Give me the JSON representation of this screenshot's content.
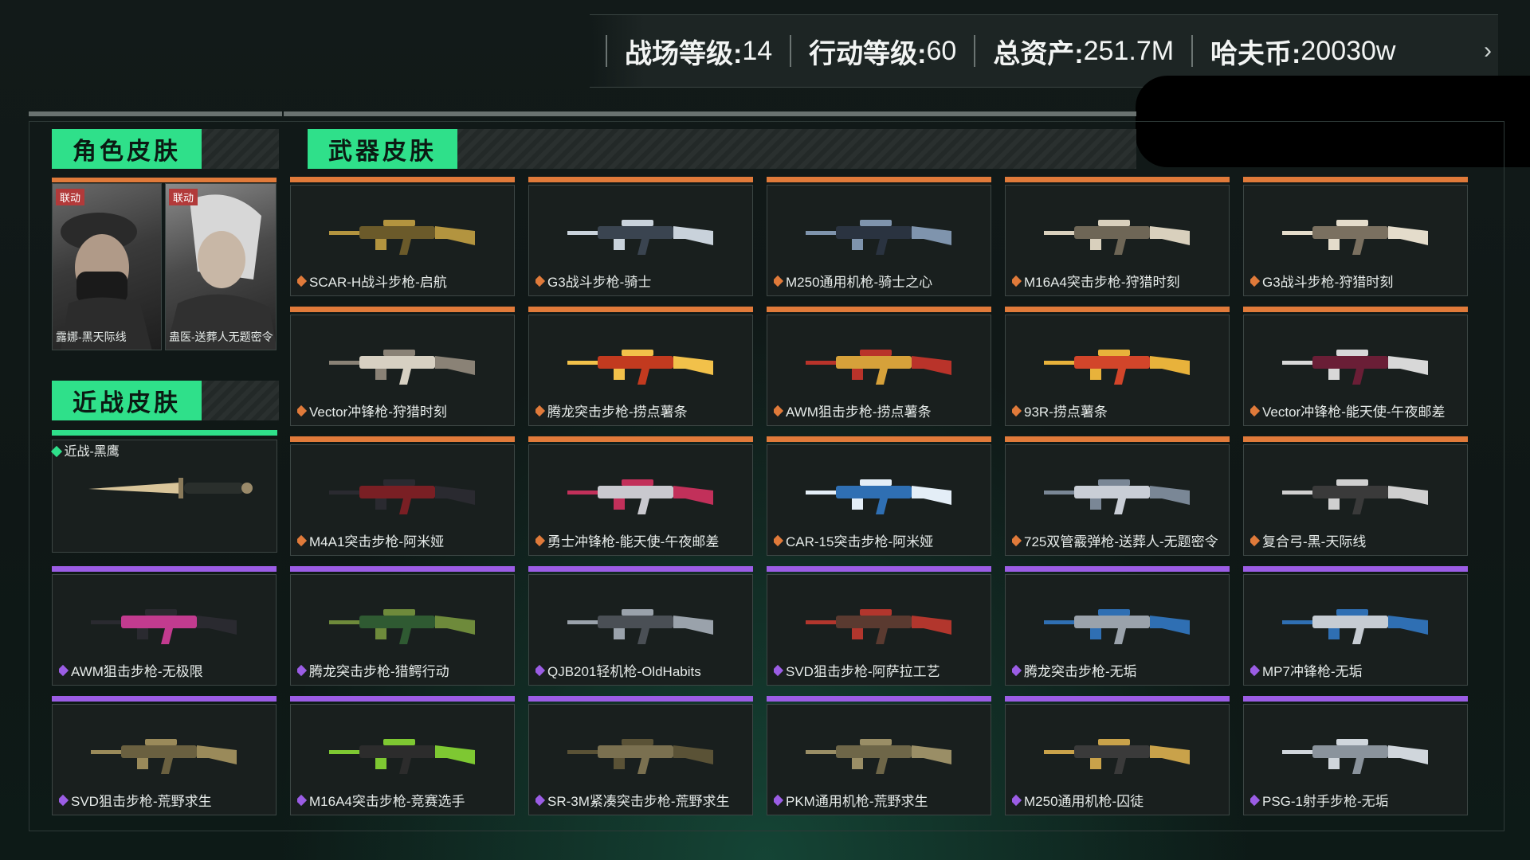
{
  "stats": [
    {
      "label": "战场等级:",
      "value": "14"
    },
    {
      "label": "行动等级:",
      "value": "60"
    },
    {
      "label": "总资产:",
      "value": "251.7M"
    },
    {
      "label": "哈夫币:",
      "value": "20030w"
    }
  ],
  "sections": {
    "character": "角色皮肤",
    "weapon": "武器皮肤",
    "melee": "近战皮肤"
  },
  "characters": [
    {
      "tag": "联动",
      "name": "露娜-黑天际线"
    },
    {
      "tag": "联动",
      "name": "蛊医-送葬人无题密令"
    }
  ],
  "melee_item": {
    "name": "近战-黑鹰"
  },
  "colors": {
    "accent": "#2fe08a",
    "orange": "#e07a3a",
    "purple": "#9b5de5"
  },
  "weapons": [
    {
      "name": "SCAR-H战斗步枪-启航",
      "tier": "orange"
    },
    {
      "name": "G3战斗步枪-骑士",
      "tier": "orange"
    },
    {
      "name": "M250通用机枪-骑士之心",
      "tier": "orange"
    },
    {
      "name": "M16A4突击步枪-狩猎时刻",
      "tier": "orange"
    },
    {
      "name": "G3战斗步枪-狩猎时刻",
      "tier": "orange"
    },
    {
      "name": "Vector冲锋枪-狩猎时刻",
      "tier": "orange"
    },
    {
      "name": "腾龙突击步枪-捞点薯条",
      "tier": "orange"
    },
    {
      "name": "AWM狙击步枪-捞点薯条",
      "tier": "orange"
    },
    {
      "name": "93R-捞点薯条",
      "tier": "orange"
    },
    {
      "name": "Vector冲锋枪-能天使-午夜邮差",
      "tier": "orange"
    },
    {
      "name": "M4A1突击步枪-阿米娅",
      "tier": "orange"
    },
    {
      "name": "勇士冲锋枪-能天使-午夜邮差",
      "tier": "orange"
    },
    {
      "name": "CAR-15突击步枪-阿米娅",
      "tier": "orange"
    },
    {
      "name": "725双管霰弹枪-送葬人-无题密令",
      "tier": "orange"
    },
    {
      "name": "复合弓-黑-天际线",
      "tier": "orange"
    },
    {
      "name": "AWM狙击步枪-无极限",
      "tier": "purple"
    },
    {
      "name": "腾龙突击步枪-猎鳄行动",
      "tier": "purple"
    },
    {
      "name": "QJB201轻机枪-OldHabits",
      "tier": "purple"
    },
    {
      "name": "SVD狙击步枪-阿萨拉工艺",
      "tier": "purple"
    },
    {
      "name": "腾龙突击步枪-无垢",
      "tier": "purple"
    },
    {
      "name": "MP7冲锋枪-无垢",
      "tier": "purple"
    },
    {
      "name": "SVD狙击步枪-荒野求生",
      "tier": "purple"
    },
    {
      "name": "M16A4突击步枪-竞赛选手",
      "tier": "purple"
    },
    {
      "name": "SR-3M紧凑突击步枪-荒野求生",
      "tier": "purple"
    },
    {
      "name": "PKM通用机枪-荒野求生",
      "tier": "purple"
    },
    {
      "name": "M250通用机枪-囚徒",
      "tier": "purple"
    },
    {
      "name": "PSG-1射手步枪-无垢",
      "tier": "purple"
    }
  ]
}
